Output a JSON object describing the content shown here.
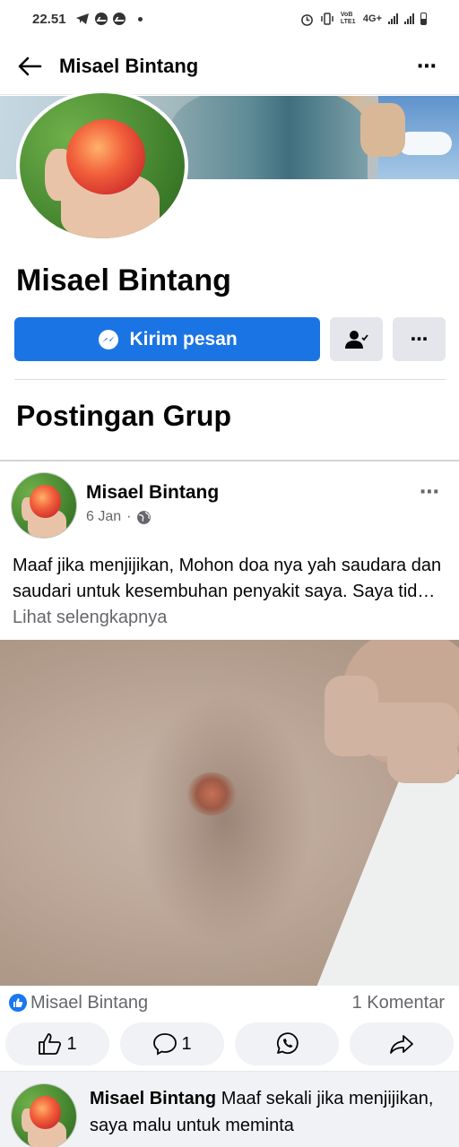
{
  "status_bar": {
    "time": "22.51",
    "network": "4G+",
    "volte": "VoB LTE1"
  },
  "header": {
    "title": "Misael Bintang",
    "more_icon": "⋯"
  },
  "profile": {
    "name": "Misael Bintang",
    "message_button": "Kirim pesan",
    "more_button": "⋯"
  },
  "section": {
    "title": "Postingan Grup"
  },
  "post": {
    "author": "Misael Bintang",
    "date": "6 Jan",
    "separator": "·",
    "text": "Maaf jika menjijikan, Mohon doa nya yah saudara dan saudari untuk kesembuhan penyakit saya. Saya tid…",
    "see_more": "Lihat selengkapnya",
    "reaction_name": "Misael Bintang",
    "comment_count": "1 Komentar",
    "like_count": "1",
    "comment_btn_count": "1",
    "more_icon": "⋯"
  },
  "comment": {
    "author": "Misael Bintang",
    "text": "Maaf sekali jika menjijikan, saya malu untuk meminta"
  },
  "colors": {
    "primary": "#1b74e4",
    "gray_btn": "#e4e6eb",
    "muted": "#65676b"
  }
}
